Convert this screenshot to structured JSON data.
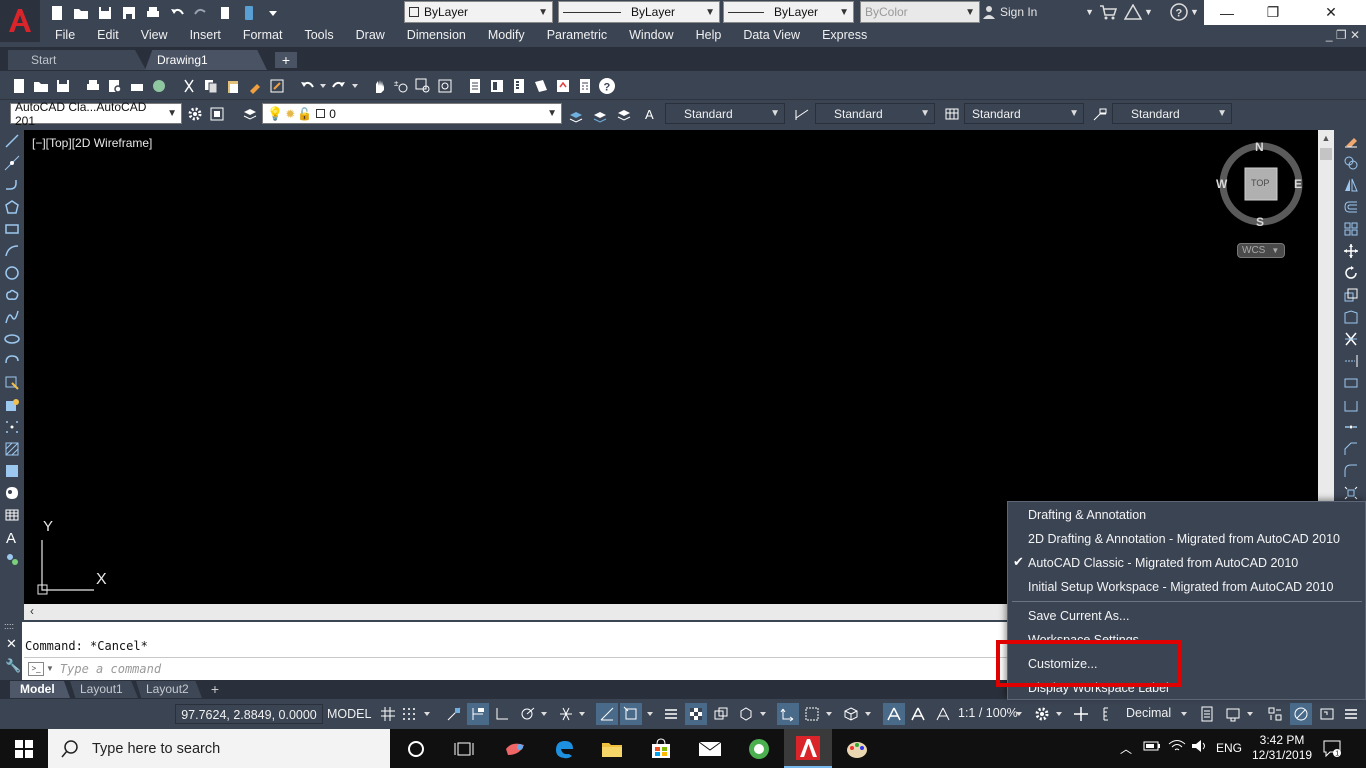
{
  "window": {
    "title_properties": {
      "color": "ByLayer",
      "linetype": "ByLayer",
      "lineweight": "ByLayer",
      "plotstyle": "ByColor"
    },
    "sign_in": "Sign In"
  },
  "menubar": {
    "items": [
      "File",
      "Edit",
      "View",
      "Insert",
      "Format",
      "Tools",
      "Draw",
      "Dimension",
      "Modify",
      "Parametric",
      "Window",
      "Help",
      "Data View",
      "Express"
    ]
  },
  "tabs": {
    "start": "Start",
    "drawing": "Drawing1"
  },
  "toolbar2": {
    "workspace_combo": "AutoCAD Cla...AutoCAD 201",
    "layer_value": "0",
    "text_style": "Standard",
    "dim_style": "Standard",
    "table_style": "Standard",
    "mleader_style": "Standard"
  },
  "viewport": {
    "label": "[−][Top][2D Wireframe]",
    "viewcube": {
      "north": "N",
      "south": "S",
      "east": "E",
      "west": "W",
      "top": "TOP",
      "wcs": "WCS"
    },
    "ucs": {
      "x": "X",
      "y": "Y"
    }
  },
  "command": {
    "history": "Command: *Cancel*",
    "placeholder": "Type a command"
  },
  "layout_tabs": [
    "Model",
    "Layout1",
    "Layout2"
  ],
  "statusbar": {
    "coordinates": "97.7624, 2.8849, 0.0000",
    "model": "MODEL",
    "scale": "1:1 / 100%",
    "units": "Decimal"
  },
  "workspace_menu": {
    "items": [
      "Drafting & Annotation",
      "2D Drafting & Annotation - Migrated from AutoCAD 2010",
      "AutoCAD Classic - Migrated from AutoCAD 2010",
      "Initial Setup Workspace - Migrated from AutoCAD 2010"
    ],
    "checked_index": 2,
    "actions": [
      "Save Current As...",
      "Workspace Settings...",
      "Customize...",
      "Display Workspace Label"
    ]
  },
  "taskbar": {
    "search_placeholder": "Type here to search",
    "language": "ENG",
    "time": "3:42 PM",
    "date": "12/31/2019"
  },
  "colors": {
    "accent_red": "#e00000",
    "ui_dark": "#3b4453",
    "canvas": "#000000"
  }
}
